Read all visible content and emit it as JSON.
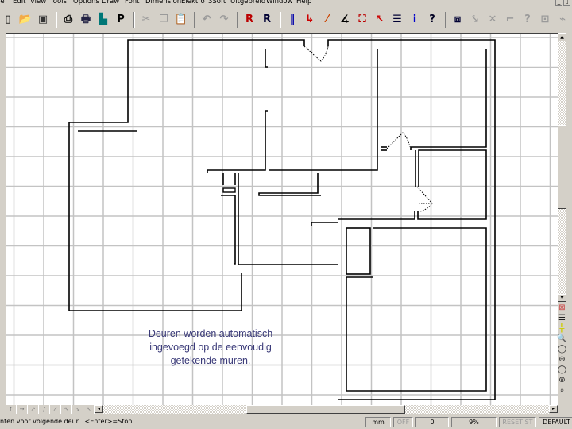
{
  "menu": [
    "le",
    "Edit",
    "View",
    "Tools",
    "Options",
    "Draw",
    "Font",
    "Dimension",
    "Elektro",
    "3Soft",
    "Uitgebreid",
    "Window",
    "Help"
  ],
  "window_controls": {
    "minimize": "_",
    "restore": "▯"
  },
  "toolbar": [
    {
      "icon": "new-icon",
      "glyph": "▯"
    },
    {
      "icon": "open-folder-icon",
      "glyph": "📂",
      "color": "#c8a000"
    },
    {
      "icon": "save-icon",
      "glyph": "▣",
      "color": "#333"
    },
    {
      "sep": true
    },
    {
      "icon": "print-icon",
      "glyph": "⎙"
    },
    {
      "icon": "print-preview-icon",
      "glyph": "🖶",
      "color": "#224"
    },
    {
      "icon": "page-setup-icon",
      "glyph": "▙",
      "color": "#077"
    },
    {
      "icon": "plot-icon",
      "glyph": "P"
    },
    {
      "sep": true
    },
    {
      "icon": "cut-icon",
      "glyph": "✂",
      "disabled": true
    },
    {
      "icon": "copy-icon",
      "glyph": "❐",
      "disabled": true
    },
    {
      "icon": "paste-icon",
      "glyph": "📋",
      "color": "#553"
    },
    {
      "sep": true
    },
    {
      "icon": "undo-icon",
      "glyph": "↶",
      "disabled": true
    },
    {
      "icon": "redo-icon",
      "glyph": "↷",
      "disabled": true
    },
    {
      "sep": true
    },
    {
      "icon": "r-symbol-red-icon",
      "glyph": "R",
      "color": "#b00"
    },
    {
      "icon": "r-symbol-blue-icon",
      "glyph": "R",
      "color": "#003"
    },
    {
      "sep": true
    },
    {
      "icon": "parallel-lines-icon",
      "glyph": "‖",
      "color": "#00a"
    },
    {
      "icon": "orthogonal-icon",
      "glyph": "↳",
      "color": "#c00"
    },
    {
      "icon": "line-point-icon",
      "glyph": "⁄",
      "color": "#c40"
    },
    {
      "icon": "angle-icon",
      "glyph": "∡"
    },
    {
      "icon": "select-frame-icon",
      "glyph": "⛶",
      "color": "#b00"
    },
    {
      "icon": "pointer-red-icon",
      "glyph": "↖",
      "color": "#c00"
    },
    {
      "icon": "layers-icon",
      "glyph": "☰",
      "color": "#003"
    },
    {
      "icon": "info-icon",
      "glyph": "i",
      "color": "#00c"
    },
    {
      "icon": "context-help-icon",
      "glyph": "?",
      "color": "#002"
    },
    {
      "sep": true
    },
    {
      "icon": "zoom-frame-icon",
      "glyph": "⧈",
      "color": "#003"
    },
    {
      "icon": "snap-icon",
      "glyph": "⤥",
      "disabled": true
    },
    {
      "icon": "cross-line-icon",
      "glyph": "✕",
      "disabled": true
    },
    {
      "icon": "corner-icon",
      "glyph": "⌐",
      "disabled": true
    },
    {
      "icon": "question-icon",
      "glyph": "?",
      "disabled": true
    },
    {
      "icon": "edit-block-icon",
      "glyph": "⊡",
      "disabled": true
    },
    {
      "icon": "break-line-icon",
      "glyph": "⌁",
      "disabled": true
    }
  ],
  "right_tools": [
    {
      "icon": "delete-box-icon",
      "glyph": "⊠",
      "color": "#c44"
    },
    {
      "icon": "lines-icon",
      "glyph": "☰"
    },
    {
      "icon": "cross-hair-icon",
      "glyph": "╬",
      "color": "#cc0"
    },
    {
      "icon": "zoom-window-icon",
      "glyph": "🔍"
    },
    {
      "icon": "zoom-icon",
      "glyph": "◯"
    },
    {
      "icon": "zoom-in-icon",
      "glyph": "⊕"
    },
    {
      "icon": "zoom-out-icon",
      "glyph": "◯"
    },
    {
      "icon": "zoom-previous-icon",
      "glyph": "⊚"
    },
    {
      "icon": "zoom-all-icon",
      "glyph": "⌕"
    }
  ],
  "bottom_tabs": [
    {
      "icon": "arrow-up-icon",
      "glyph": "↑"
    },
    {
      "icon": "arrow-right-icon",
      "glyph": "→"
    },
    {
      "icon": "arrow-diagonal-icon",
      "glyph": "↗"
    },
    {
      "icon": "slash-icon",
      "glyph": "/"
    },
    {
      "icon": "slash-thin-icon",
      "glyph": "⁄"
    },
    {
      "icon": "arrow-nw-icon",
      "glyph": "↖"
    },
    {
      "icon": "arrow-se-icon",
      "glyph": "↘"
    },
    {
      "icon": "arrow-back-icon",
      "glyph": "↖"
    }
  ],
  "note": [
    "Deuren worden automatisch",
    "ingevoegd op de eenvoudig",
    "getekende muren."
  ],
  "status": {
    "message": "nten voor volgende deur   <Enter>=Stop",
    "unit": "mm",
    "snap": "OFF",
    "value": "0",
    "zoom": "9%",
    "preset": "RESET ST",
    "layer": "DEFAULT"
  },
  "colors": {
    "wall": "#000000",
    "grid": "#c3c3c3",
    "note": "#3a3a78",
    "canvas": "#ffffff",
    "chrome": "#d4d0c8"
  }
}
